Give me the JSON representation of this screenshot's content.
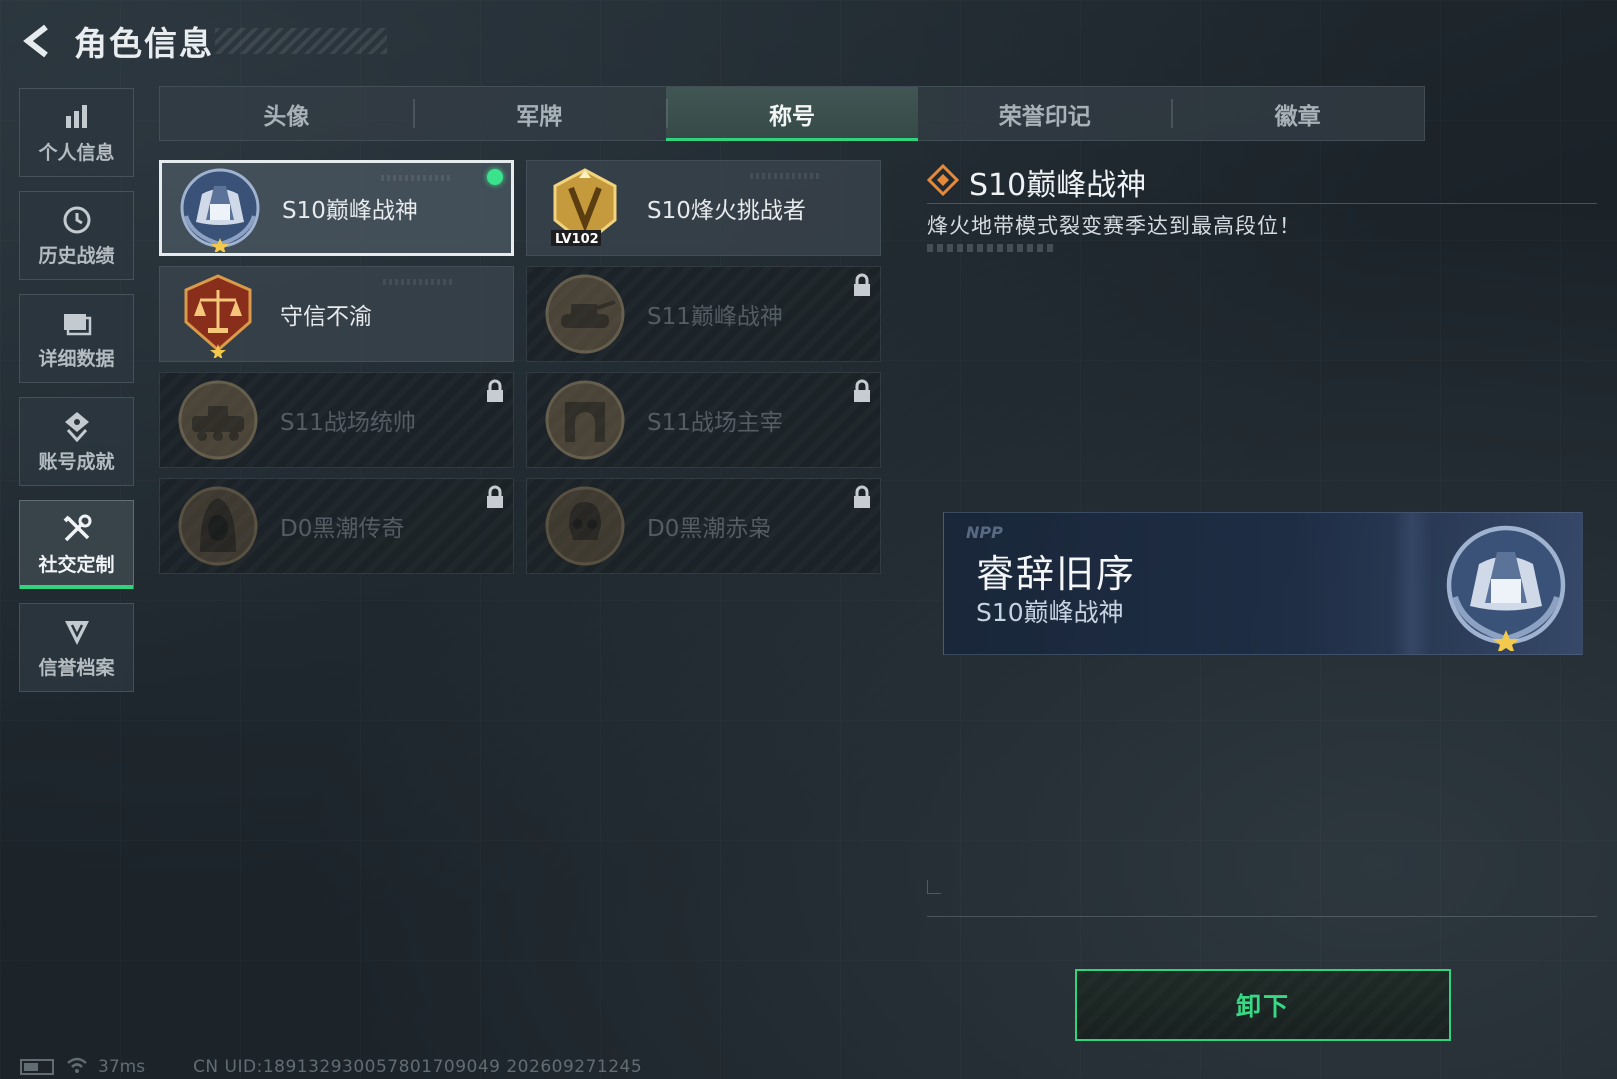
{
  "header": {
    "title": "角色信息"
  },
  "sidebar": {
    "items": [
      {
        "label": "个人信息",
        "icon": "bar-chart-icon"
      },
      {
        "label": "历史战绩",
        "icon": "clock-icon"
      },
      {
        "label": "详细数据",
        "icon": "folder-icon"
      },
      {
        "label": "账号成就",
        "icon": "achievement-icon"
      },
      {
        "label": "社交定制",
        "icon": "tools-icon",
        "active": true
      },
      {
        "label": "信誉档案",
        "icon": "shield-icon"
      }
    ]
  },
  "tabs": [
    {
      "label": "头像"
    },
    {
      "label": "军牌"
    },
    {
      "label": "称号",
      "active": true
    },
    {
      "label": "荣誉印记"
    },
    {
      "label": "徽章"
    }
  ],
  "titles": [
    {
      "name": "S10巅峰战神",
      "state": "equipped",
      "emblem": "peak-god-emblem"
    },
    {
      "name": "S10烽火挑战者",
      "state": "unlocked",
      "emblem": "challenger-emblem",
      "level_badge": "LV102"
    },
    {
      "name": "守信不渝",
      "state": "unlocked",
      "emblem": "scales-emblem"
    },
    {
      "name": "S11巅峰战神",
      "state": "locked",
      "emblem": "tank-emblem"
    },
    {
      "name": "S11战场统帅",
      "state": "locked",
      "emblem": "vehicle-emblem"
    },
    {
      "name": "S11战场主宰",
      "state": "locked",
      "emblem": "arch-emblem"
    },
    {
      "name": "D0黑潮传奇",
      "state": "locked",
      "emblem": "hooded-emblem"
    },
    {
      "name": "D0黑潮赤枭",
      "state": "locked",
      "emblem": "skull-emblem"
    }
  ],
  "detail": {
    "title": "S10巅峰战神",
    "description": "烽火地带模式裂变赛季达到最高段位！",
    "nameplate": {
      "tag": "NPP",
      "player_name": "睿辞旧序",
      "title": "S10巅峰战神"
    },
    "unequip_label": "卸下"
  },
  "status": {
    "ping": "37ms",
    "uid": "CN UID:18913293005780170904​9 202609271245"
  },
  "colors": {
    "accent": "#2fd47d",
    "equipped_dot": "#3be38c",
    "background": "#1f272d"
  }
}
